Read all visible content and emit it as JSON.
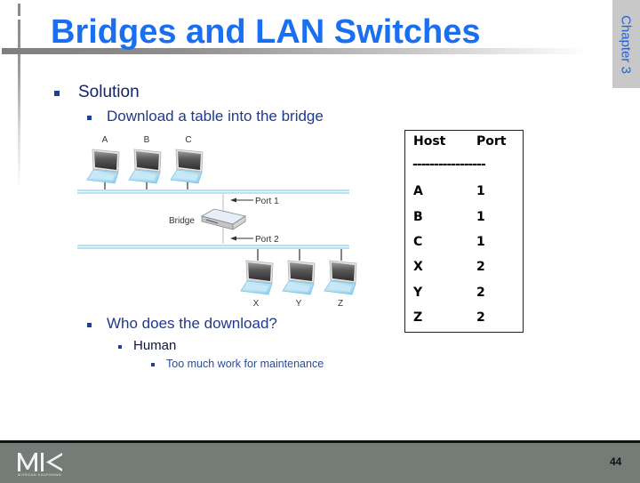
{
  "slide": {
    "title": "Bridges and LAN Switches",
    "chapter_tab": "Chapter 3",
    "page_number": "44",
    "publisher_logo": {
      "mark": "MK",
      "subtitle": "MORGAN KAUFMANN"
    }
  },
  "bullets": {
    "solution": "Solution",
    "download_table": "Download a table into the bridge",
    "who_downloads": "Who does the download?",
    "human": "Human",
    "too_much_work": "Too much work for maintenance"
  },
  "diagram": {
    "top_hosts": [
      "A",
      "B",
      "C"
    ],
    "bottom_hosts": [
      "X",
      "Y",
      "Z"
    ],
    "bridge_label": "Bridge",
    "port1_label": "Port 1",
    "port2_label": "Port 2",
    "lan_color": "#b9e2f2",
    "screen_color": "#4a4a4a",
    "keyboard_color": "#a9dcf2"
  },
  "forwarding_table": {
    "headers": [
      "Host",
      "Port"
    ],
    "separator": "-----------------",
    "rows": [
      {
        "host": "A",
        "port": "1"
      },
      {
        "host": "B",
        "port": "1"
      },
      {
        "host": "C",
        "port": "1"
      },
      {
        "host": "X",
        "port": "2"
      },
      {
        "host": "Y",
        "port": "2"
      },
      {
        "host": "Z",
        "port": "2"
      }
    ]
  },
  "colors": {
    "title": "#1a6ff0",
    "footer": "#737c77"
  }
}
